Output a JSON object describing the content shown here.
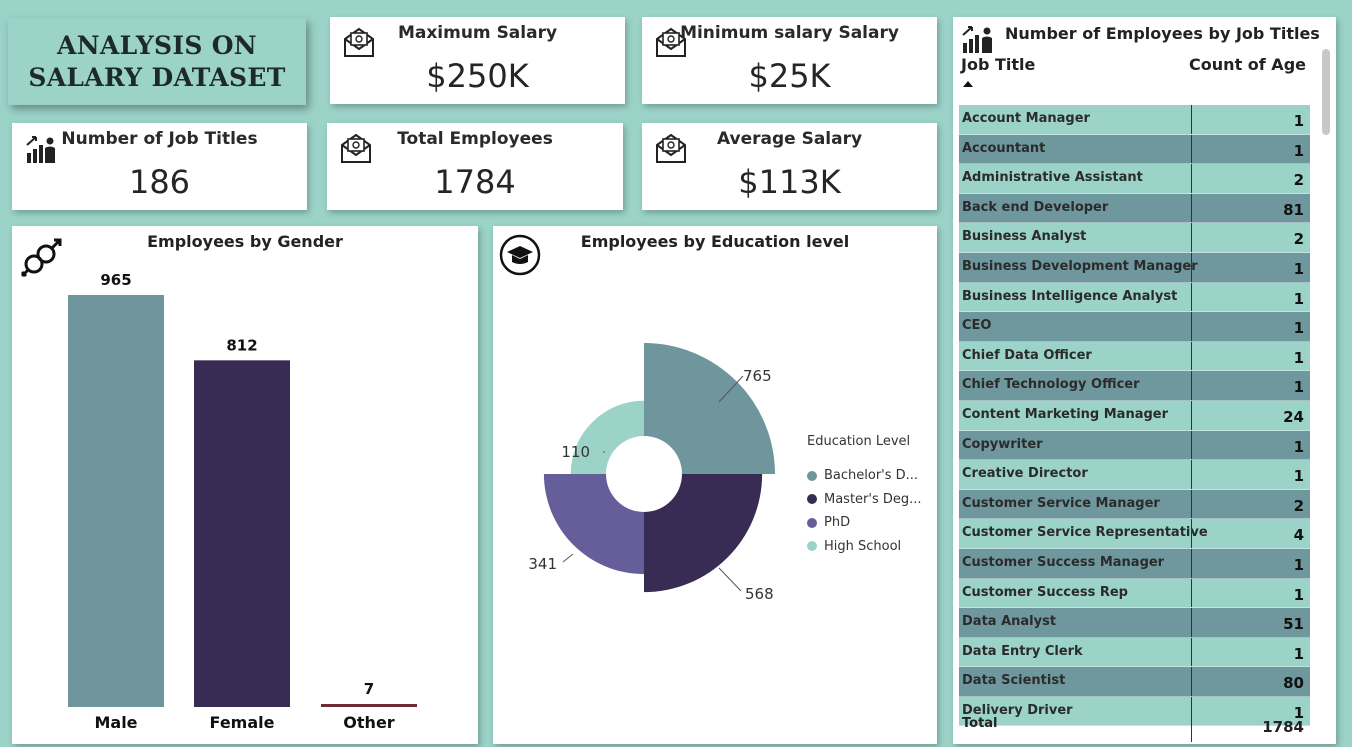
{
  "title": {
    "text": "ANALYSIS ON\nSALARY DATASET"
  },
  "kpis": {
    "max_salary": {
      "label": "Maximum Salary",
      "value": "$250K"
    },
    "min_salary": {
      "label": "Minimum salary Salary",
      "value": "$25K"
    },
    "job_titles": {
      "label": "Number of Job Titles",
      "value": "186"
    },
    "total_employees": {
      "label": "Total Employees",
      "value": "1784"
    },
    "avg_salary": {
      "label": "Average Salary",
      "value": "$113K"
    }
  },
  "gender_chart": {
    "title": "Employees by Gender",
    "chart_data": {
      "type": "bar",
      "categories": [
        "Male",
        "Female",
        "Other"
      ],
      "values": [
        965,
        812,
        7
      ],
      "colors": [
        "#6e969c",
        "#382b54",
        "#6b2b33"
      ]
    }
  },
  "education_chart": {
    "title": "Employees by Education level",
    "legend_title": "Education Level",
    "chart_data": {
      "type": "pie",
      "categories": [
        "Bachelor's D...",
        "Master's Deg...",
        "PhD",
        "High School"
      ],
      "values": [
        765,
        568,
        341,
        110
      ],
      "colors": [
        "#6e969c",
        "#382b54",
        "#665e9a",
        "#9bd3c9"
      ]
    }
  },
  "job_table": {
    "title": "Number of Employees by Job Titles",
    "col_job": "Job Title",
    "col_count": "Count of Age",
    "rows": [
      {
        "job": "Account Manager",
        "count": "1"
      },
      {
        "job": "Accountant",
        "count": "1"
      },
      {
        "job": "Administrative Assistant",
        "count": "2"
      },
      {
        "job": "Back end Developer",
        "count": "81"
      },
      {
        "job": "Business Analyst",
        "count": "2"
      },
      {
        "job": "Business Development Manager",
        "count": "1"
      },
      {
        "job": "Business Intelligence Analyst",
        "count": "1"
      },
      {
        "job": "CEO",
        "count": "1"
      },
      {
        "job": "Chief Data Officer",
        "count": "1"
      },
      {
        "job": "Chief Technology Officer",
        "count": "1"
      },
      {
        "job": "Content Marketing Manager",
        "count": "24"
      },
      {
        "job": "Copywriter",
        "count": "1"
      },
      {
        "job": "Creative Director",
        "count": "1"
      },
      {
        "job": "Customer Service Manager",
        "count": "2"
      },
      {
        "job": "Customer Service Representative",
        "count": "4"
      },
      {
        "job": "Customer Success Manager",
        "count": "1"
      },
      {
        "job": "Customer Success Rep",
        "count": "1"
      },
      {
        "job": "Data Analyst",
        "count": "51"
      },
      {
        "job": "Data Entry Clerk",
        "count": "1"
      },
      {
        "job": "Data Scientist",
        "count": "80"
      },
      {
        "job": "Delivery Driver",
        "count": "1"
      }
    ],
    "total_label": "Total",
    "total_value": "1784"
  }
}
